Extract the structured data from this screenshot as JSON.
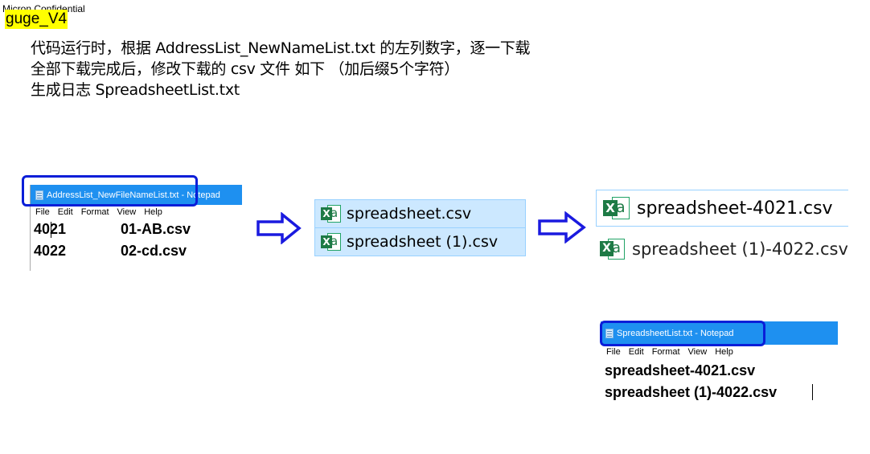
{
  "header": {
    "confidential": "Micron Confidential",
    "tag": "guge_V4"
  },
  "description": {
    "line1": "代码运行时，根据 AddressList_NewNameList.txt 的左列数字，逐一下载",
    "line2": "全部下载完成后，修改下载的 csv 文件 如下 （加后缀5个字符）",
    "line3": "生成日志 SpreadsheetList.txt"
  },
  "notepad1": {
    "title": "AddressList_NewFileNameList.txt - Notepad",
    "menu": [
      "File",
      "Edit",
      "Format",
      "View",
      "Help"
    ],
    "rows": [
      {
        "id": "4021",
        "name": "01-AB.csv"
      },
      {
        "id": "4022",
        "name": "02-cd.csv"
      }
    ]
  },
  "downloads": {
    "files": [
      "spreadsheet.csv",
      "spreadsheet (1).csv"
    ]
  },
  "renamed": {
    "files": [
      "spreadsheet-4021.csv",
      "spreadsheet (1)-4022.csv"
    ]
  },
  "notepad2": {
    "title": "SpreadsheetList.txt - Notepad",
    "menu": [
      "File",
      "Edit",
      "Format",
      "View",
      "Help"
    ],
    "lines": [
      "spreadsheet-4021.csv",
      "spreadsheet (1)-4022.csv"
    ]
  },
  "icons": {
    "excel": "excel-file-icon",
    "arrow": "right-arrow-icon",
    "notepad": "notepad-icon"
  },
  "colors": {
    "highlight": "#ffff00",
    "titlebar": "#1e90f0",
    "annotation_box": "#0a1ed8",
    "selection": "#cce8ff",
    "excel_green": "#1d7a45",
    "arrow": "#1a1adf"
  }
}
